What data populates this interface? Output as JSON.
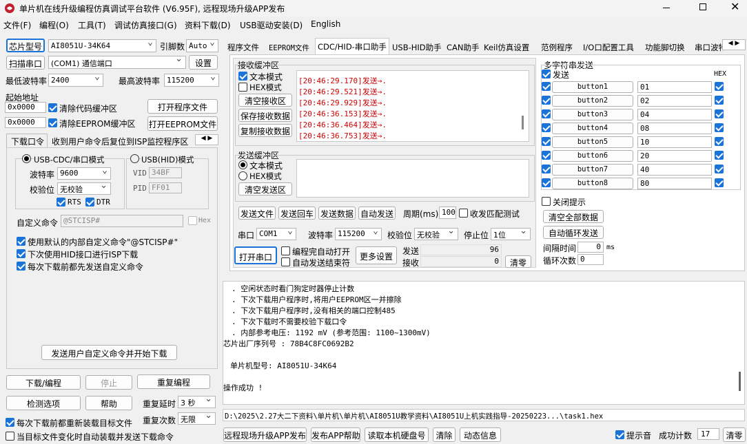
{
  "window": {
    "title": "单片机在线升级编程仿真调试平台软件 (V6.95F), 远程现场升级APP发布"
  },
  "menu": [
    "文件(F)",
    "编程(O)",
    "工具(T)",
    "调试仿真接口(G)",
    "资料下载(D)",
    "USB驱动安装(D)",
    "English"
  ],
  "left": {
    "chip_btn": "芯片型号",
    "chip_value": "AI8051U-34K64",
    "pin_label": "引脚数",
    "pin_value": "Auto",
    "scan_btn": "扫描串口",
    "port_value": "(COM1) 通信端口",
    "settings_btn": "设置",
    "min_baud_label": "最低波特率",
    "min_baud": "2400",
    "max_baud_label": "最高波特率",
    "max_baud": "115200",
    "start_addr_label": "起始地址",
    "addr1": "0x0000",
    "clear_code": "清除代码缓冲区",
    "open_prog": "打开程序文件",
    "addr2": "0x0000",
    "clear_eeprom": "清除EEPROM缓冲区",
    "open_eeprom": "打开EEPROM文件",
    "tabs": [
      "下载口令",
      "收到用户命令后复位到ISP监控程序区"
    ],
    "cdc_mode": "USB-CDC/串口模式",
    "hid_mode": "USB(HID)模式",
    "baud_label": "波特率",
    "baud": "9600",
    "parity_label": "校验位",
    "parity": "无校验",
    "rts": "RTS",
    "dtr": "DTR",
    "vid_label": "VID",
    "vid": "34BF",
    "pid_label": "PID",
    "pid": "FF01",
    "custom_cmd_label": "自定义命令",
    "custom_cmd": "@STCISP#",
    "hex": "Hex",
    "opt1": "使用默认的内部自定义命令\"@STCISP#\"",
    "opt2": "下次使用HID接口进行ISP下载",
    "opt3": "每次下载前都先发送自定义命令",
    "send_custom_btn": "发送用户自定义命令并开始下载",
    "download_btn": "下载/编程",
    "stop_btn": "停止",
    "reprog_btn": "重复编程",
    "detect_btn": "检测选项",
    "help_btn": "帮助",
    "repeat_delay_label": "重复延时",
    "repeat_delay": "3 秒",
    "repeat_count_label": "重复次数",
    "repeat_count": "无限",
    "reload_each": "每次下载前都重新装载目标文件",
    "auto_send_change": "当目标文件变化时自动装载并发送下载命令"
  },
  "right_tabs": [
    "程序文件",
    "EEPROM文件",
    "CDC/HID-串口助手",
    "USB-HID助手",
    "CAN助手",
    "Keil仿真设置",
    "范例程序",
    "I/O口配置工具",
    "功能脚切换",
    "串口波特"
  ],
  "serial": {
    "recv_title": "接收缓冲区",
    "text_mode": "文本模式",
    "hex_mode": "HEX模式",
    "clear_recv": "清空接收区",
    "save_recv": "保存接收数据",
    "copy_recv": "复制接收数据",
    "recv_lines": [
      "[20:46:29.170]发送→.",
      "[20:46:29.521]发送→.",
      "[20:46:29.929]发送→.",
      "[20:46:36.153]发送→.",
      "[20:46:36.464]发送→.",
      "[20:46:36.753]发送→."
    ],
    "send_title": "发送缓冲区",
    "s_text_mode": "文本模式",
    "s_hex_mode": "HEX模式",
    "clear_send": "清空发送区",
    "send_file": "发送文件",
    "send_cr": "发送回车",
    "send_data": "发送数据",
    "auto_send": "自动发送",
    "period_label": "周期(ms)",
    "period": "100",
    "match_test": "收发匹配测试",
    "port_label": "串口",
    "port": "COM1",
    "baud_label": "波特率",
    "baud": "115200",
    "parity_label": "校验位",
    "parity": "无校验",
    "stop_label": "停止位",
    "stop": "1位",
    "open_port": "打开串口",
    "auto_open": "编程完自动打开",
    "auto_end": "自动发送结束符",
    "more": "更多设置",
    "sent_label": "发送",
    "sent": "96",
    "recv_label": "接收",
    "recv": "0",
    "clear": "清零"
  },
  "multi": {
    "title": "多字符串发送",
    "send_label": "发送",
    "hex_label": "HEX",
    "rows": [
      {
        "name": "button1",
        "val": "01"
      },
      {
        "name": "button2",
        "val": "02"
      },
      {
        "name": "button3",
        "val": "04"
      },
      {
        "name": "button4",
        "val": "08"
      },
      {
        "name": "button5",
        "val": "10"
      },
      {
        "name": "button6",
        "val": "20"
      },
      {
        "name": "button7",
        "val": "40"
      },
      {
        "name": "button8",
        "val": "80"
      }
    ],
    "close_hint": "关闭提示",
    "clear_all": "清空全部数据",
    "auto_loop": "自动循环发送",
    "interval_label": "间隔时间",
    "interval": "0",
    "interval_unit": "ms",
    "loop_label": "循环次数",
    "loop": "0"
  },
  "log": {
    "lines": [
      ". 空闲状态时看门狗定时器停止计数",
      ". 下次下载用户程序时,将用户EEPROM区一并擦除",
      ". 下次下载用户程序时,没有相关的端口控制485",
      ". 下次下载时不需要校验下载口令",
      ". 内部参考电压: 1192 mV (参考范围: 1100~1300mV)",
      "芯片出厂序列号 : 78B4C8FC0692B2",
      "",
      "单片机型号: AI8051U-34K64",
      "",
      "操作成功 !"
    ],
    "path": "D:\\2025\\2.27大二下资料\\单片机\\单片机\\AI8051U教学资料\\AI8051U上机实践指导-20250223...\\task1.hex"
  },
  "bottom": {
    "remote_btn": "远程现场升级APP发布",
    "publish_help": "发布APP帮助",
    "read_disk": "读取本机硬盘号",
    "clear": "清除",
    "dynamic": "动态信息",
    "beep": "提示音",
    "success_label": "成功计数",
    "success": "17",
    "clear2": "清零"
  }
}
